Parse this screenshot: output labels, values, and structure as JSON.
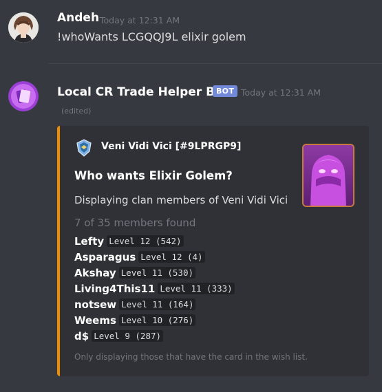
{
  "messages": {
    "user": {
      "username": "Andeh",
      "timestamp": "Today at 12:31 AM",
      "text": "!whoWants LCGQQJ9L elixir golem"
    },
    "bot": {
      "username": "Local CR Trade Helper Bot",
      "tag": "BOT",
      "timestamp": "Today at 12:31 AM",
      "edited": "(edited)",
      "embed": {
        "accent_color": "#f08c00",
        "author": "Veni Vidi Vici [#9LPRGP9]",
        "title": "Who wants Elixir Golem?",
        "description": "Displaying clan members of Veni Vidi Vici",
        "count": "7 of 35 members found",
        "members": [
          {
            "name": "Lefty",
            "level": "Level 12 (542)"
          },
          {
            "name": "Asparagus",
            "level": "Level 12 (4)"
          },
          {
            "name": "Akshay",
            "level": "Level 11 (530)"
          },
          {
            "name": "Living4This11",
            "level": "Level 11 (333)"
          },
          {
            "name": "notsew",
            "level": "Level 11 (164)"
          },
          {
            "name": "Weems",
            "level": "Level 10 (276)"
          },
          {
            "name": "d$",
            "level": "Level 9 (287)"
          }
        ],
        "footer": "Only displaying those that have the card in the wish list."
      }
    }
  },
  "icons": {
    "user_avatar": "anime-character-avatar",
    "bot_avatar": "cards-icon",
    "clan_badge": "clan-badge-icon",
    "thumbnail": "elixir-golem-card-image"
  }
}
